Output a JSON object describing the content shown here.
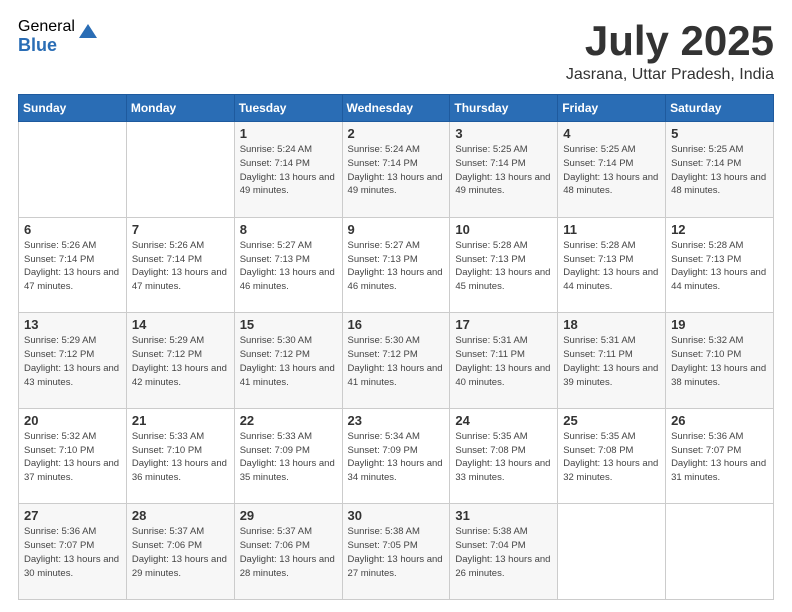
{
  "header": {
    "logo_general": "General",
    "logo_blue": "Blue",
    "month_title": "July 2025",
    "location": "Jasrana, Uttar Pradesh, India"
  },
  "calendar": {
    "days_of_week": [
      "Sunday",
      "Monday",
      "Tuesday",
      "Wednesday",
      "Thursday",
      "Friday",
      "Saturday"
    ],
    "weeks": [
      [
        {
          "day": "",
          "info": ""
        },
        {
          "day": "",
          "info": ""
        },
        {
          "day": "1",
          "info": "Sunrise: 5:24 AM\nSunset: 7:14 PM\nDaylight: 13 hours and 49 minutes."
        },
        {
          "day": "2",
          "info": "Sunrise: 5:24 AM\nSunset: 7:14 PM\nDaylight: 13 hours and 49 minutes."
        },
        {
          "day": "3",
          "info": "Sunrise: 5:25 AM\nSunset: 7:14 PM\nDaylight: 13 hours and 49 minutes."
        },
        {
          "day": "4",
          "info": "Sunrise: 5:25 AM\nSunset: 7:14 PM\nDaylight: 13 hours and 48 minutes."
        },
        {
          "day": "5",
          "info": "Sunrise: 5:25 AM\nSunset: 7:14 PM\nDaylight: 13 hours and 48 minutes."
        }
      ],
      [
        {
          "day": "6",
          "info": "Sunrise: 5:26 AM\nSunset: 7:14 PM\nDaylight: 13 hours and 47 minutes."
        },
        {
          "day": "7",
          "info": "Sunrise: 5:26 AM\nSunset: 7:14 PM\nDaylight: 13 hours and 47 minutes."
        },
        {
          "day": "8",
          "info": "Sunrise: 5:27 AM\nSunset: 7:13 PM\nDaylight: 13 hours and 46 minutes."
        },
        {
          "day": "9",
          "info": "Sunrise: 5:27 AM\nSunset: 7:13 PM\nDaylight: 13 hours and 46 minutes."
        },
        {
          "day": "10",
          "info": "Sunrise: 5:28 AM\nSunset: 7:13 PM\nDaylight: 13 hours and 45 minutes."
        },
        {
          "day": "11",
          "info": "Sunrise: 5:28 AM\nSunset: 7:13 PM\nDaylight: 13 hours and 44 minutes."
        },
        {
          "day": "12",
          "info": "Sunrise: 5:28 AM\nSunset: 7:13 PM\nDaylight: 13 hours and 44 minutes."
        }
      ],
      [
        {
          "day": "13",
          "info": "Sunrise: 5:29 AM\nSunset: 7:12 PM\nDaylight: 13 hours and 43 minutes."
        },
        {
          "day": "14",
          "info": "Sunrise: 5:29 AM\nSunset: 7:12 PM\nDaylight: 13 hours and 42 minutes."
        },
        {
          "day": "15",
          "info": "Sunrise: 5:30 AM\nSunset: 7:12 PM\nDaylight: 13 hours and 41 minutes."
        },
        {
          "day": "16",
          "info": "Sunrise: 5:30 AM\nSunset: 7:12 PM\nDaylight: 13 hours and 41 minutes."
        },
        {
          "day": "17",
          "info": "Sunrise: 5:31 AM\nSunset: 7:11 PM\nDaylight: 13 hours and 40 minutes."
        },
        {
          "day": "18",
          "info": "Sunrise: 5:31 AM\nSunset: 7:11 PM\nDaylight: 13 hours and 39 minutes."
        },
        {
          "day": "19",
          "info": "Sunrise: 5:32 AM\nSunset: 7:10 PM\nDaylight: 13 hours and 38 minutes."
        }
      ],
      [
        {
          "day": "20",
          "info": "Sunrise: 5:32 AM\nSunset: 7:10 PM\nDaylight: 13 hours and 37 minutes."
        },
        {
          "day": "21",
          "info": "Sunrise: 5:33 AM\nSunset: 7:10 PM\nDaylight: 13 hours and 36 minutes."
        },
        {
          "day": "22",
          "info": "Sunrise: 5:33 AM\nSunset: 7:09 PM\nDaylight: 13 hours and 35 minutes."
        },
        {
          "day": "23",
          "info": "Sunrise: 5:34 AM\nSunset: 7:09 PM\nDaylight: 13 hours and 34 minutes."
        },
        {
          "day": "24",
          "info": "Sunrise: 5:35 AM\nSunset: 7:08 PM\nDaylight: 13 hours and 33 minutes."
        },
        {
          "day": "25",
          "info": "Sunrise: 5:35 AM\nSunset: 7:08 PM\nDaylight: 13 hours and 32 minutes."
        },
        {
          "day": "26",
          "info": "Sunrise: 5:36 AM\nSunset: 7:07 PM\nDaylight: 13 hours and 31 minutes."
        }
      ],
      [
        {
          "day": "27",
          "info": "Sunrise: 5:36 AM\nSunset: 7:07 PM\nDaylight: 13 hours and 30 minutes."
        },
        {
          "day": "28",
          "info": "Sunrise: 5:37 AM\nSunset: 7:06 PM\nDaylight: 13 hours and 29 minutes."
        },
        {
          "day": "29",
          "info": "Sunrise: 5:37 AM\nSunset: 7:06 PM\nDaylight: 13 hours and 28 minutes."
        },
        {
          "day": "30",
          "info": "Sunrise: 5:38 AM\nSunset: 7:05 PM\nDaylight: 13 hours and 27 minutes."
        },
        {
          "day": "31",
          "info": "Sunrise: 5:38 AM\nSunset: 7:04 PM\nDaylight: 13 hours and 26 minutes."
        },
        {
          "day": "",
          "info": ""
        },
        {
          "day": "",
          "info": ""
        }
      ]
    ]
  }
}
